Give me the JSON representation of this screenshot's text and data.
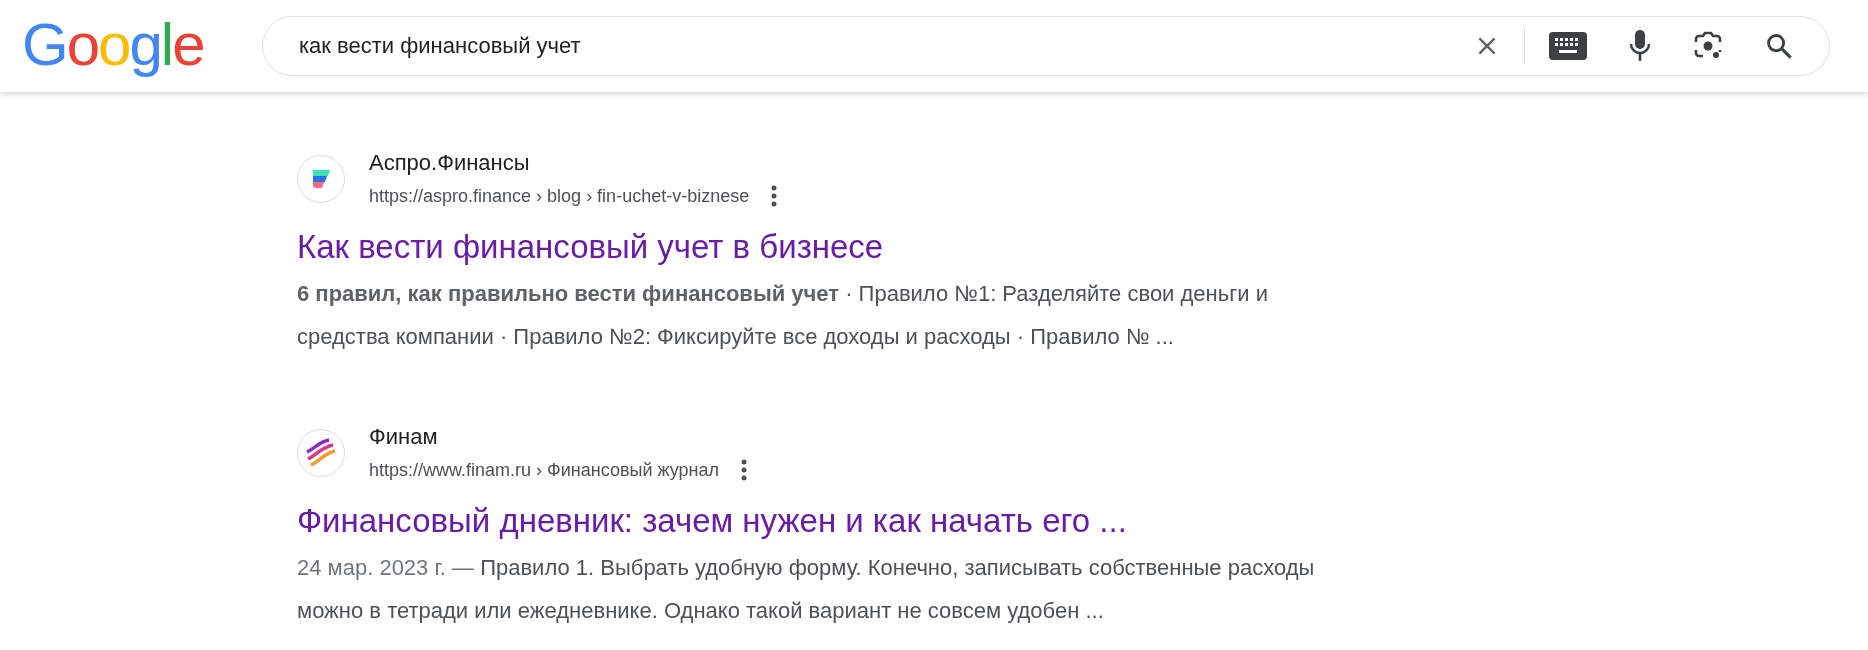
{
  "header": {
    "logo": "Google",
    "search": {
      "value": "как вести финансовый учет"
    }
  },
  "results": [
    {
      "kind": "aspro",
      "site": "Аспро.Финансы",
      "url": "https://aspro.finance › blog › fin-uchet-v-biznese",
      "title": "Как вести финансовый учет в бизнесе",
      "snippet": "**6 правил, как правильно вести финансовый учет** · Правило №1: Разделяйте свои деньги и средства компании · Правило №2: Фиксируйте все доходы и расходы · Правило № ..."
    },
    {
      "kind": "finam",
      "site": "Финам",
      "url": "https://www.finam.ru › Финансовый журнал",
      "title": "Финансовый дневник: зачем нужен и как начать его ...",
      "date": "24 мар. 2023 г. — ",
      "snippet": "Правило 1. Выбрать удобную форму. Конечно, записывать собственные расходы можно в тетради или ежедневнике. Однако такой вариант не совсем удобен ..."
    }
  ]
}
